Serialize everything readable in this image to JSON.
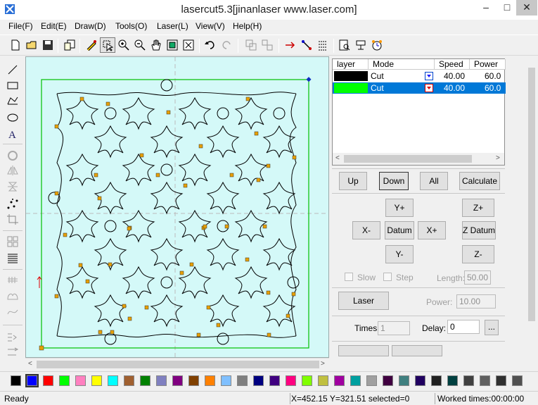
{
  "window": {
    "title": "lasercut5.3[jinanlaser www.laser.com]",
    "min_glyph": "–",
    "max_glyph": "□",
    "close_glyph": "✕"
  },
  "menu": [
    "File(F)",
    "Edit(E)",
    "Draw(D)",
    "Tools(O)",
    "Laser(L)",
    "View(V)",
    "Help(H)"
  ],
  "toolbar": {
    "icons": [
      "new-file-icon",
      "open-folder-icon",
      "save-icon",
      "import-icon",
      "pen-icon",
      "select-icon",
      "zoom-in-icon",
      "zoom-out-icon",
      "pan-hand-icon",
      "zoom-page-icon",
      "zoom-fit-icon",
      "undo-icon",
      "redo-icon",
      "group-icon",
      "ungroup-icon",
      "laser-path-icon",
      "path-order-icon",
      "array-icon",
      "preview-icon",
      "laser-head-icon",
      "timer-icon"
    ]
  },
  "left_tools": [
    "line-icon",
    "rectangle-icon",
    "polyline-icon",
    "ellipse-icon",
    "text-icon",
    "rotate-icon",
    "mirror-h-icon",
    "mirror-v-icon",
    "node-edit-icon",
    "crop-icon",
    "align-icon",
    "distribute-icon",
    "hatch-icon",
    "smooth-icon",
    "curve-icon",
    "offset-icon",
    "size-icon"
  ],
  "layers": {
    "headers": [
      "layer",
      "Mode",
      "Speed",
      "Power"
    ],
    "rows": [
      {
        "color": "#000000",
        "mode": "Cut",
        "speed": "40.00",
        "power": "60.0",
        "selected": false
      },
      {
        "color": "#00ff00",
        "mode": "Cut",
        "speed": "40.00",
        "power": "60.0",
        "selected": true
      }
    ],
    "left_arrow": "<",
    "right_arrow": ">"
  },
  "buttons": {
    "up": "Up",
    "down": "Down",
    "all": "All",
    "calculate": "Calculate",
    "y_plus": "Y+",
    "x_minus": "X-",
    "datum": "Datum",
    "x_plus": "X+",
    "y_minus": "Y-",
    "z_plus": "Z+",
    "z_datum": "Z Datum",
    "z_minus": "Z-",
    "laser": "Laser",
    "more": "..."
  },
  "options": {
    "slow_label": "Slow",
    "step_label": "Step",
    "length_label": "Length:",
    "length_value": "50.00",
    "power_label": "Power:",
    "power_value": "10.00",
    "times_label": "Times:",
    "times_value": "1",
    "delay_label": "Delay:",
    "delay_value": "0"
  },
  "palette": [
    "#000000",
    "#0000ff",
    "#ff0000",
    "#00ff00",
    "#ff80c0",
    "#ffff00",
    "#00ffff",
    "#a06030",
    "#008000",
    "#8080c0",
    "#800080",
    "#804000",
    "#ff8000",
    "#80c0ff",
    "#808080",
    "#000080",
    "#400080",
    "#ff0080",
    "#80ff00",
    "#c0c040",
    "#a000a0",
    "#00a0a0",
    "#a0a0a0",
    "#400040",
    "#408080",
    "#200060",
    "#202020",
    "#004040",
    "#404040",
    "#606060",
    "#303030",
    "#505050"
  ],
  "status": {
    "ready": "Ready",
    "coords": "X=452.15 Y=321.51 selected=0",
    "worked": "Worked times:00:00:00"
  }
}
